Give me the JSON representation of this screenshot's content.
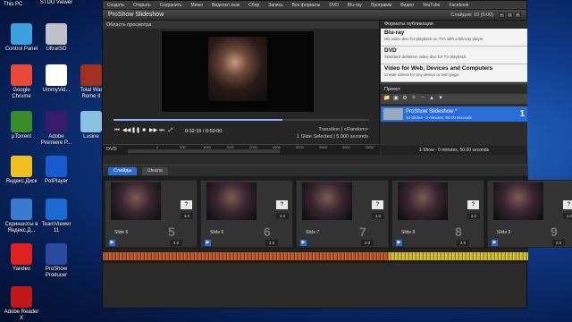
{
  "desktop": {
    "this_pc": "This PC",
    "icons": [
      {
        "label": "STDU Viewer",
        "color": "#5a8fd8"
      },
      {
        "label": "Control Panel",
        "color": "#3aa0e0"
      },
      {
        "label": "UltraISO",
        "color": "#c0c0c8"
      },
      {
        "label": "Google Chrome",
        "color": "#e84a3a"
      },
      {
        "label": "UmmyVid...",
        "color": "#ffffff"
      },
      {
        "label": "Total War Rome II",
        "color": "#a03020"
      },
      {
        "label": "µTorrent",
        "color": "#3a8a2a"
      },
      {
        "label": "Adobe Premiere P...",
        "color": "#3a1a6a"
      },
      {
        "label": "Lusine",
        "color": "#8ac0e0"
      },
      {
        "label": "Яндекс.Диск",
        "color": "#f0c020"
      },
      {
        "label": "PotPlayer",
        "color": "#1a5ad0"
      },
      {
        "label": "Скриншоты в Яндекс.Д...",
        "color": "#3a7ad0"
      },
      {
        "label": "TeamViewer 11",
        "color": "#1a6ad0"
      },
      {
        "label": "Yandex",
        "color": "#e02020"
      },
      {
        "label": "ProShow Producer",
        "color": "#2a4aa0"
      },
      {
        "label": "Adobe Reader X",
        "color": "#c01818"
      }
    ]
  },
  "menubar": [
    "Создать",
    "Открыть",
    "Сохранить",
    "Меню",
    "Видеокл знак",
    "Сбор",
    "Запись",
    "Все форматы",
    "DVD",
    "Blu-ray",
    "Программ",
    "Видео",
    "YouTube",
    "Facebook"
  ],
  "window": {
    "title": "ProShow Slideshow",
    "slides_counter": "Слайдов: 10 (5:00)"
  },
  "preview": {
    "title": "Область просмотра",
    "time": "0:32:15 / 0:50:00",
    "transition": "Transition  |  <Random>",
    "selection_info": "1 Slide Selected  |  5.000 seconds",
    "progress_percent": 66,
    "ruler_label": "DVD",
    "ruler_ticks": [
      "0",
      "500",
      "1000",
      "1500",
      "2000",
      "2500",
      "3000",
      "3500",
      "4000",
      "4500"
    ]
  },
  "formats": {
    "title": "Форматы публикации",
    "items": [
      {
        "title": "Blu-ray",
        "desc": "HD video disc for playback on TVs with a Blu-ray player."
      },
      {
        "title": "DVD",
        "desc": "Standard definition video disc for TV playback."
      },
      {
        "title": "Video for Web, Devices and Computers",
        "desc": "Create videos for any device or web page."
      }
    ]
  },
  "project": {
    "title": "Проект",
    "item_name": "ProShow Slideshow *",
    "item_sub": "10 Slides - 0 minutes, 50.00 seconds",
    "item_num": "1",
    "status": "1 Show - 0 minutes, 50.00 seconds"
  },
  "tabs": [
    "Слайды",
    "Шкала"
  ],
  "slides": [
    {
      "name": "Slide 5",
      "num": "5",
      "dur": "3.0",
      "tdur": "2.0"
    },
    {
      "name": "Slide 6",
      "num": "6",
      "dur": "3.0",
      "tdur": "2.0"
    },
    {
      "name": "Slide 7",
      "num": "7",
      "dur": "3.0",
      "tdur": "2.0"
    },
    {
      "name": "Slide 8",
      "num": "8",
      "dur": "3.0",
      "tdur": "2.0"
    },
    {
      "name": "Slide 9",
      "num": "9",
      "dur": "3.0",
      "tdur": "2.0"
    }
  ]
}
